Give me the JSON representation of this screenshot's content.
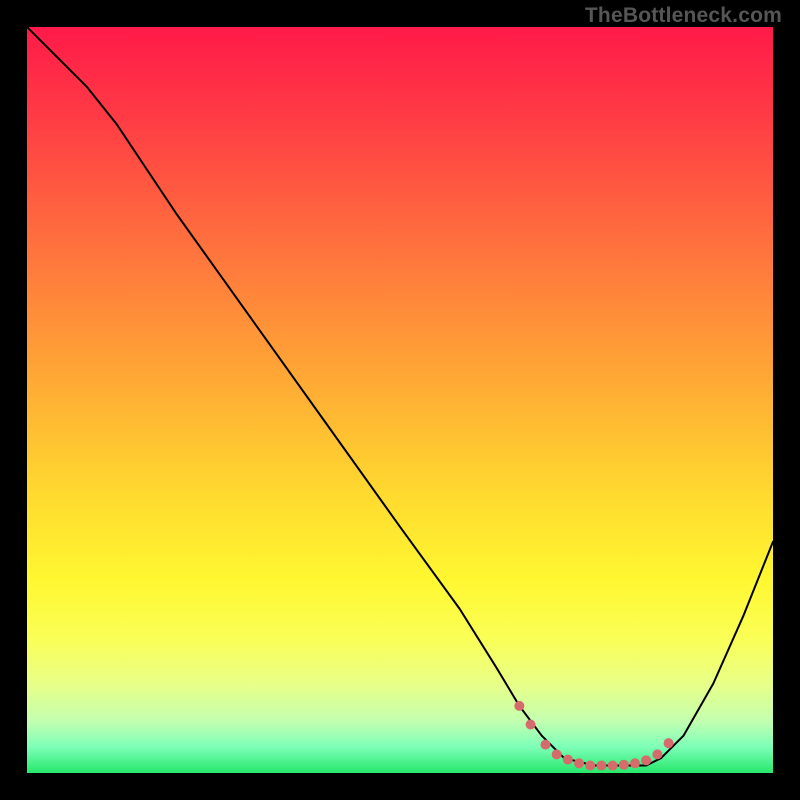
{
  "watermark": "TheBottleneck.com",
  "chart_data": {
    "type": "line",
    "title": "",
    "xlabel": "",
    "ylabel": "",
    "xlim": [
      0,
      100
    ],
    "ylim": [
      0,
      100
    ],
    "background_gradient": {
      "stops": [
        {
          "offset": 0.0,
          "color": "#ff1a49"
        },
        {
          "offset": 0.12,
          "color": "#ff3b45"
        },
        {
          "offset": 0.28,
          "color": "#ff6d3e"
        },
        {
          "offset": 0.45,
          "color": "#ffa236"
        },
        {
          "offset": 0.62,
          "color": "#ffd82f"
        },
        {
          "offset": 0.74,
          "color": "#fff730"
        },
        {
          "offset": 0.82,
          "color": "#faff57"
        },
        {
          "offset": 0.88,
          "color": "#e8ff87"
        },
        {
          "offset": 0.93,
          "color": "#c4ffb0"
        },
        {
          "offset": 0.965,
          "color": "#7dffb8"
        },
        {
          "offset": 1.0,
          "color": "#26e86b"
        }
      ]
    },
    "series": [
      {
        "name": "bottleneck-curve",
        "stroke": "#000000",
        "stroke_width": 2,
        "x": [
          0,
          3,
          8,
          12,
          20,
          30,
          40,
          50,
          58,
          63,
          66,
          69,
          72,
          76,
          80,
          83,
          85,
          88,
          92,
          96,
          100
        ],
        "y": [
          100,
          97,
          92,
          87,
          75,
          61,
          47,
          33,
          22,
          14,
          9,
          5,
          2,
          1,
          1,
          1,
          2,
          5,
          12,
          21,
          31
        ]
      }
    ],
    "markers": {
      "name": "optimal-band-dots",
      "fill": "#d66b6b",
      "radius_px": 5,
      "points": [
        {
          "x": 66.0,
          "y": 9.0
        },
        {
          "x": 67.5,
          "y": 6.5
        },
        {
          "x": 69.5,
          "y": 3.8
        },
        {
          "x": 71.0,
          "y": 2.5
        },
        {
          "x": 72.5,
          "y": 1.8
        },
        {
          "x": 74.0,
          "y": 1.3
        },
        {
          "x": 75.5,
          "y": 1.0
        },
        {
          "x": 77.0,
          "y": 1.0
        },
        {
          "x": 78.5,
          "y": 1.0
        },
        {
          "x": 80.0,
          "y": 1.1
        },
        {
          "x": 81.5,
          "y": 1.3
        },
        {
          "x": 83.0,
          "y": 1.7
        },
        {
          "x": 84.5,
          "y": 2.5
        },
        {
          "x": 86.0,
          "y": 4.0
        }
      ]
    }
  }
}
